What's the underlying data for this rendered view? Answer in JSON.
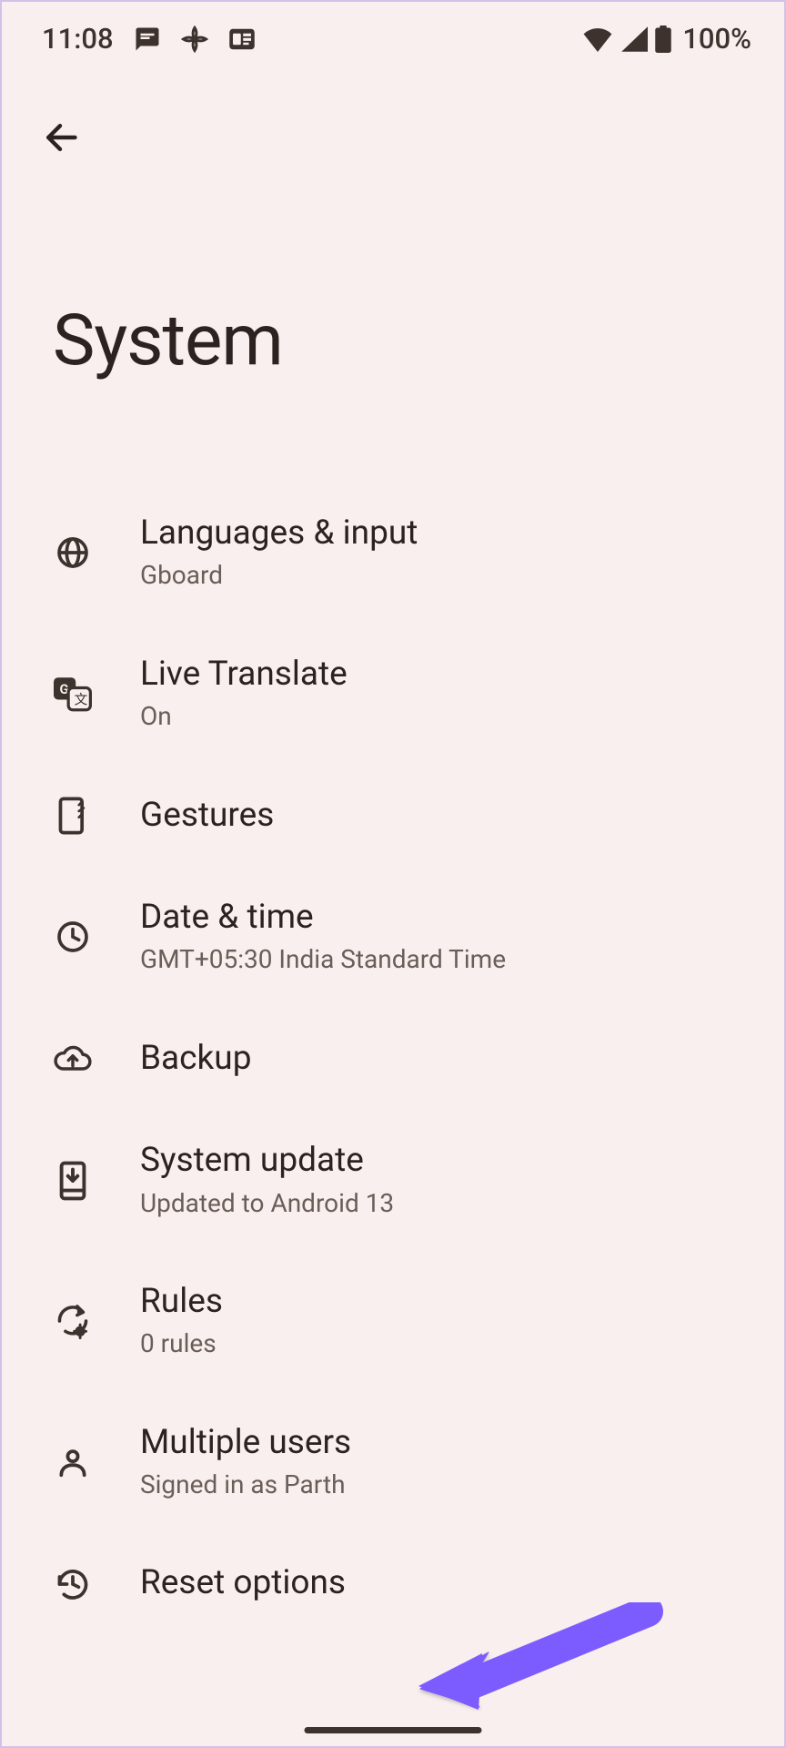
{
  "statusBar": {
    "time": "11:08",
    "battery": "100%"
  },
  "pageTitle": "System",
  "settings": {
    "items": [
      {
        "icon": "globe-icon",
        "title": "Languages & input",
        "subtitle": "Gboard"
      },
      {
        "icon": "translate-icon",
        "title": "Live Translate",
        "subtitle": "On"
      },
      {
        "icon": "phone-sparkle-icon",
        "title": "Gestures",
        "subtitle": ""
      },
      {
        "icon": "clock-icon",
        "title": "Date & time",
        "subtitle": "GMT+05:30 India Standard Time"
      },
      {
        "icon": "cloud-up-icon",
        "title": "Backup",
        "subtitle": ""
      },
      {
        "icon": "phone-down-icon",
        "title": "System update",
        "subtitle": "Updated to Android 13"
      },
      {
        "icon": "cycle-gear-icon",
        "title": "Rules",
        "subtitle": "0 rules"
      },
      {
        "icon": "person-icon",
        "title": "Multiple users",
        "subtitle": "Signed in as Parth"
      },
      {
        "icon": "history-icon",
        "title": "Reset options",
        "subtitle": ""
      }
    ]
  }
}
